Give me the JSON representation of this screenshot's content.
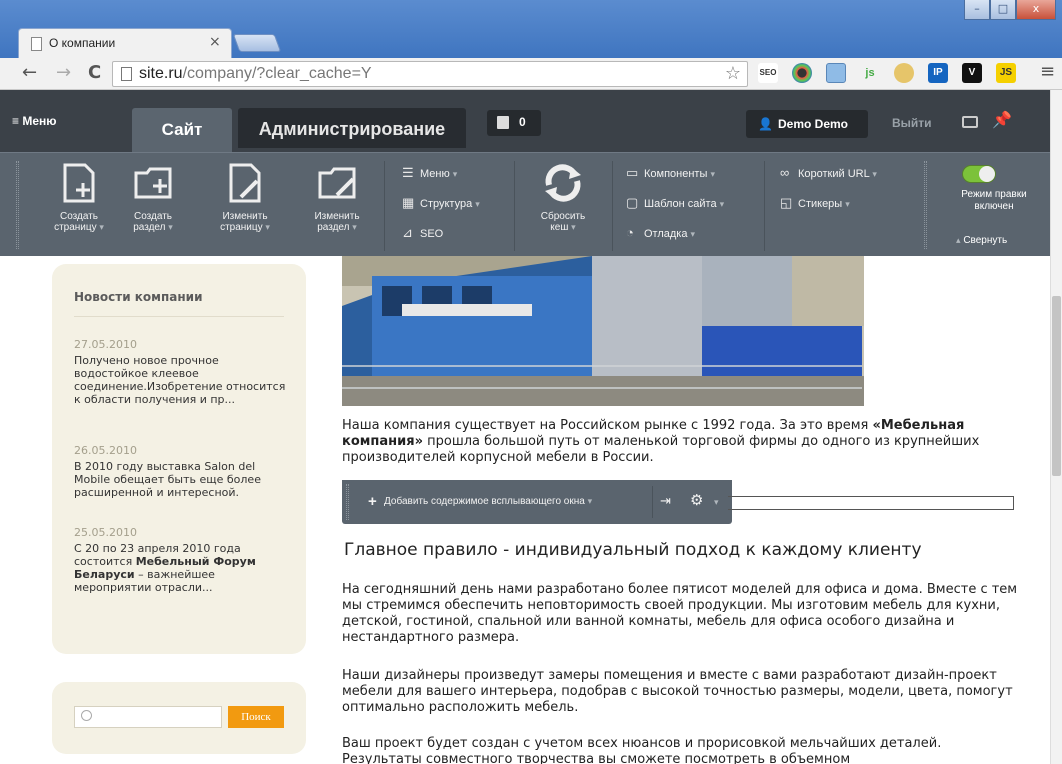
{
  "browser": {
    "tab_title": "О компании",
    "tab_close": "×",
    "url_host": "site.ru",
    "url_path": "/company/?clear_cache=Y",
    "window_controls": [
      "–",
      "□",
      "x"
    ],
    "extensions": [
      "SEO",
      "",
      "",
      "js",
      "",
      "IP",
      "V",
      "JS"
    ]
  },
  "admin": {
    "menu_label": "≡  Меню",
    "tab_site": "Сайт",
    "tab_admin": "Администрирование",
    "notifications": "0",
    "user_name": "Demo Demo",
    "logout": "Выйти",
    "buttons": {
      "create_page": [
        "Создать",
        "страницу"
      ],
      "create_section": [
        "Создать",
        "раздел"
      ],
      "edit_page": [
        "Изменить",
        "страницу"
      ],
      "edit_section": [
        "Изменить",
        "раздел"
      ],
      "reset_cache": [
        "Сбросить",
        "кеш"
      ]
    },
    "small": {
      "menu": "Меню",
      "structure": "Структура",
      "seo": "SEO",
      "components": "Компоненты",
      "template": "Шаблон сайта",
      "debug": "Отладка",
      "short_url": "Короткий URL",
      "stickers": "Стикеры"
    },
    "edit_mode": [
      "Режим правки",
      "включен"
    ],
    "collapse": "Свернуть"
  },
  "sidebar": {
    "news_title": "Новости компании",
    "news": [
      {
        "date": "27.05.2010",
        "text": "Получено новое прочное водостойкое клеевое соединение.Изобретение относится к области получения и пр..."
      },
      {
        "date": "26.05.2010",
        "text": "В 2010 году выставка Salon del Mobile обещает быть еще более расширенной и интересной."
      },
      {
        "date": "25.05.2010",
        "text_pre": "С 20 по 23 апреля 2010 года состоится ",
        "text_bold": "Мебельный Форум Беларуси",
        "text_post": " – важнейшее мероприятии отрасли..."
      }
    ],
    "search_button": "Поиск"
  },
  "article": {
    "intro_pre": "Наша компания существует на Российском рынке с 1992 года. За это время ",
    "intro_bold": "«Мебельная компания»",
    "intro_post": " прошла большой путь от маленькой торговой фирмы до одного из крупнейших производителей корпусной мебели в России.",
    "popup_add": "Добавить содержимое всплывающего окна",
    "heading": "Главное правило - индивидуальный подход к каждому клиенту",
    "p1": "На сегодняшний день нами разработано более пятисот моделей для офиса и дома. Вместе с тем мы стремимся обеспечить неповторимость своей продукции. Мы изготовим мебель для кухни, детской, гостиной, спальной или ванной комнаты, мебель для офиса особого дизайна и нестандартного размера.",
    "p2": "Наши дизайнеры произведут замеры помещения и вместе с вами разработают дизайн-проект мебели для вашего интерьера, подобрав с высокой точностью размеры, модели, цвета, помогут оптимально расположить мебель.",
    "p3": "Ваш проект будет создан с учетом всех нюансов и прорисовкой мельчайших деталей. Результаты совместного творчества вы сможете посмотреть в объемном"
  }
}
